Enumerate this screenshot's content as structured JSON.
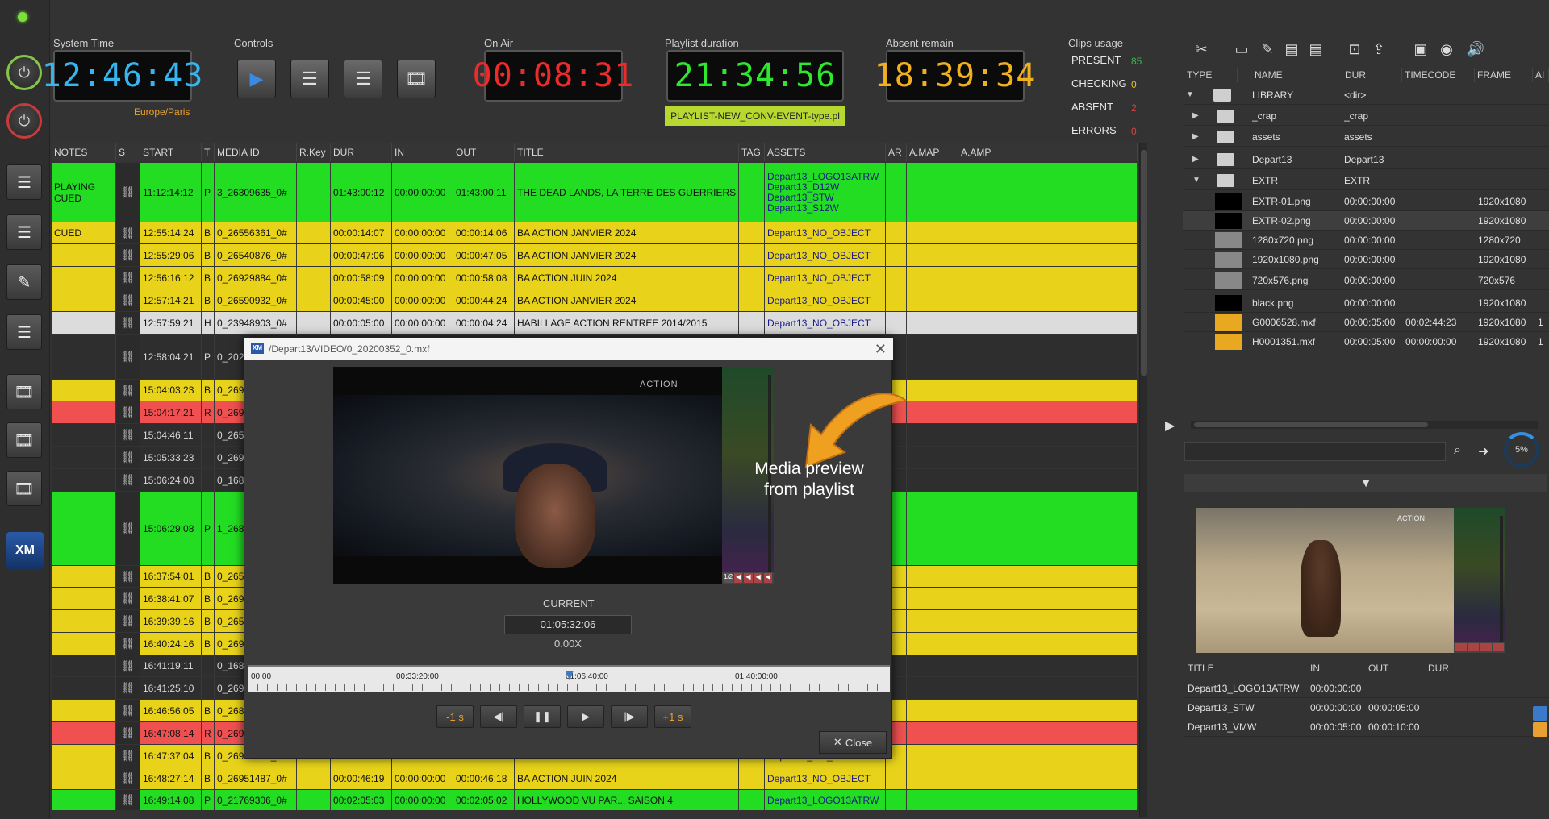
{
  "header": {
    "system_time_label": "System Time",
    "system_time": "12:46:43",
    "timezone": "Europe/Paris",
    "controls_label": "Controls",
    "on_air_label": "On Air",
    "on_air": "00:08:31",
    "playlist_duration_label": "Playlist duration",
    "playlist_duration": "21:34:56",
    "playlist_name": "PLAYLIST-NEW_CONV-EVENT-type.pl",
    "absent_remain_label": "Absent remain",
    "absent_remain": "18:39:34",
    "clips_usage_label": "Clips usage",
    "clips_usage": [
      {
        "label": "PRESENT",
        "value": "85",
        "color": "#39b54a"
      },
      {
        "label": "CHECKING",
        "value": "0",
        "color": "#e8c21a"
      },
      {
        "label": "ABSENT",
        "value": "2",
        "color": "#e04040"
      },
      {
        "label": "ERRORS",
        "value": "0",
        "color": "#e04040"
      }
    ]
  },
  "playlist": {
    "columns": [
      "NOTES",
      "S",
      "START",
      "T",
      "MEDIA ID",
      "R.Key",
      "DUR",
      "IN",
      "OUT",
      "TITLE",
      "TAG",
      "ASSETS",
      "AR",
      "A.MAP",
      "A.AMP"
    ],
    "rows": [
      {
        "notes": "PLAYING CUED",
        "start": "11:12:14:12",
        "t": "P",
        "media": "3_26309635_0#",
        "dur": "01:43:00:12",
        "in": "00:00:00:00",
        "out": "01:43:00:11",
        "title": "THE DEAD LANDS, LA TERRE DES GUERRIERS",
        "assets": "Depart13_LOGO13ATRW",
        "assets2": "Depart13_D12W",
        "assets3": "Depart13_STW",
        "assets4": "Depart13_S12W"
      },
      {
        "notes": "CUED",
        "start": "12:55:14:24",
        "t": "B",
        "media": "0_26556361_0#",
        "dur": "00:00:14:07",
        "in": "00:00:00:00",
        "out": "00:00:14:06",
        "title": "BA ACTION JANVIER 2024",
        "assets": "Depart13_NO_OBJECT"
      },
      {
        "notes": "",
        "start": "12:55:29:06",
        "t": "B",
        "media": "0_26540876_0#",
        "dur": "00:00:47:06",
        "in": "00:00:00:00",
        "out": "00:00:47:05",
        "title": "BA ACTION JANVIER 2024",
        "assets": "Depart13_NO_OBJECT"
      },
      {
        "notes": "",
        "start": "12:56:16:12",
        "t": "B",
        "media": "0_26929884_0#",
        "dur": "00:00:58:09",
        "in": "00:00:00:00",
        "out": "00:00:58:08",
        "title": "BA ACTION JUIN 2024",
        "assets": "Depart13_NO_OBJECT"
      },
      {
        "notes": "",
        "start": "12:57:14:21",
        "t": "B",
        "media": "0_26590932_0#",
        "dur": "00:00:45:00",
        "in": "00:00:00:00",
        "out": "00:00:44:24",
        "title": "BA ACTION JANVIER 2024",
        "assets": "Depart13_NO_OBJECT"
      },
      {
        "notes": "",
        "start": "12:57:59:21",
        "t": "H",
        "media": "0_23948903_0#",
        "dur": "00:00:05:00",
        "in": "00:00:00:00",
        "out": "00:00:04:24",
        "title": "HABILLAGE ACTION RENTREE 2014/2015",
        "assets": "Depart13_NO_OBJECT"
      },
      {
        "notes": "",
        "start": "12:58:04:21",
        "t": "P",
        "media": "0_202",
        "dur": "",
        "in": "",
        "out": "",
        "title": "",
        "assets": ""
      },
      {
        "notes": "",
        "start": "15:04:03:23",
        "t": "B",
        "media": "0_269",
        "dur": "",
        "in": "",
        "out": "",
        "title": "",
        "assets": ""
      },
      {
        "notes": "",
        "start": "15:04:17:21",
        "t": "R",
        "media": "0_269",
        "dur": "",
        "in": "",
        "out": "",
        "title": "",
        "assets": ""
      },
      {
        "notes": "",
        "start": "15:04:46:11",
        "t": "",
        "media": "0_265",
        "dur": "",
        "in": "",
        "out": "",
        "title": "",
        "assets": ""
      },
      {
        "notes": "",
        "start": "15:05:33:23",
        "t": "",
        "media": "0_269",
        "dur": "",
        "in": "",
        "out": "",
        "title": "",
        "assets": ""
      },
      {
        "notes": "",
        "start": "15:06:24:08",
        "t": "",
        "media": "0_168",
        "dur": "",
        "in": "",
        "out": "",
        "title": "",
        "assets": ""
      },
      {
        "notes": "",
        "start": "15:06:29:08",
        "t": "P",
        "media": "1_268",
        "dur": "",
        "in": "",
        "out": "",
        "title": "",
        "assets": ""
      },
      {
        "notes": "",
        "start": "16:37:54:01",
        "t": "B",
        "media": "0_265",
        "dur": "",
        "in": "",
        "out": "",
        "title": "",
        "assets": ""
      },
      {
        "notes": "",
        "start": "16:38:41:07",
        "t": "B",
        "media": "0_269",
        "dur": "",
        "in": "",
        "out": "",
        "title": "",
        "assets": ""
      },
      {
        "notes": "",
        "start": "16:39:39:16",
        "t": "B",
        "media": "0_265",
        "dur": "",
        "in": "",
        "out": "",
        "title": "",
        "assets": ""
      },
      {
        "notes": "",
        "start": "16:40:24:16",
        "t": "B",
        "media": "0_269",
        "dur": "",
        "in": "",
        "out": "",
        "title": "",
        "assets": ""
      },
      {
        "notes": "",
        "start": "16:41:19:11",
        "t": "",
        "media": "0_168",
        "dur": "",
        "in": "",
        "out": "",
        "title": "",
        "assets": ""
      },
      {
        "notes": "",
        "start": "16:41:25:10",
        "t": "",
        "media": "0_269",
        "dur": "",
        "in": "",
        "out": "",
        "title": "",
        "assets": ""
      },
      {
        "notes": "",
        "start": "16:46:56:05",
        "t": "B",
        "media": "0_268",
        "dur": "",
        "in": "",
        "out": "",
        "title": "",
        "assets": ""
      },
      {
        "notes": "",
        "start": "16:47:08:14",
        "t": "R",
        "media": "0_269",
        "dur": "",
        "in": "",
        "out": "",
        "title": "",
        "assets": ""
      },
      {
        "notes": "",
        "start": "16:47:37:04",
        "t": "B",
        "media": "0_26919313_0#",
        "dur": "00:00:50:10",
        "in": "00:00:00:00",
        "out": "00:00:50:09",
        "title": "BA ACTION JUIN 2024",
        "assets": "Depart13_NO_OBJECT"
      },
      {
        "notes": "",
        "start": "16:48:27:14",
        "t": "B",
        "media": "0_26951487_0#",
        "dur": "00:00:46:19",
        "in": "00:00:00:00",
        "out": "00:00:46:18",
        "title": "BA ACTION JUIN 2024",
        "assets": "Depart13_NO_OBJECT"
      },
      {
        "notes": "",
        "start": "16:49:14:08",
        "t": "P",
        "media": "0_21769306_0#",
        "dur": "00:02:05:03",
        "in": "00:00:00:00",
        "out": "00:02:05:02",
        "title": "HOLLYWOOD VU PAR... SAISON 4",
        "assets": "Depart13_LOGO13ATRW"
      }
    ]
  },
  "dialog": {
    "title": "/Depart13/VIDEO/0_20200352_0.mxf",
    "watermark": "ACTION",
    "meter_label": "1/2",
    "callout_line1": "Media preview",
    "callout_line2": "from playlist",
    "current_label": "CURRENT",
    "current_tc": "01:05:32:06",
    "speed": "0.00X",
    "timeline_ticks": [
      "00:00",
      "00:33:20:00",
      "01:06:40:00",
      "01:40:00:00"
    ],
    "buttons": {
      "back1s": "-1 s",
      "prev": "◀|",
      "pause": "❚❚",
      "play": "▶",
      "next": "|▶",
      "fwd1s": "+1 s"
    },
    "close_label": "Close"
  },
  "library": {
    "columns": [
      "TYPE",
      "NAME",
      "DUR",
      "TIMECODE",
      "FRAME",
      "AI"
    ],
    "rows": [
      {
        "expander": "▼",
        "name": "LIBRARY",
        "dur": "<dir>",
        "tc": "",
        "frame": "",
        "kind": "folder",
        "level": 0
      },
      {
        "expander": "▶",
        "name": "_crap",
        "dur": "_crap",
        "tc": "",
        "frame": "",
        "kind": "folder",
        "level": 1
      },
      {
        "expander": "▶",
        "name": "assets",
        "dur": "assets",
        "tc": "",
        "frame": "",
        "kind": "folder",
        "level": 1
      },
      {
        "expander": "▶",
        "name": "Depart13",
        "dur": "Depart13",
        "tc": "",
        "frame": "",
        "kind": "folder",
        "level": 1
      },
      {
        "expander": "▼",
        "name": "EXTR",
        "dur": "EXTR",
        "tc": "",
        "frame": "",
        "kind": "folder",
        "level": 1
      },
      {
        "expander": "",
        "name": "EXTR-01.png",
        "dur": "00:00:00:00",
        "tc": "",
        "frame": "1920x1080",
        "kind": "black",
        "level": 2
      },
      {
        "expander": "",
        "name": "EXTR-02.png",
        "dur": "00:00:00:00",
        "tc": "",
        "frame": "1920x1080",
        "kind": "black",
        "level": 2
      },
      {
        "expander": "",
        "name": "1280x720.png",
        "dur": "00:00:00:00",
        "tc": "",
        "frame": "1280x720",
        "kind": "gray",
        "level": 1
      },
      {
        "expander": "",
        "name": "1920x1080.png",
        "dur": "00:00:00:00",
        "tc": "",
        "frame": "1920x1080",
        "kind": "gray",
        "level": 1
      },
      {
        "expander": "",
        "name": "720x576.png",
        "dur": "00:00:00:00",
        "tc": "",
        "frame": "720x576",
        "kind": "gray",
        "level": 1
      },
      {
        "expander": "",
        "name": "black.png",
        "dur": "00:00:00:00",
        "tc": "",
        "frame": "1920x1080",
        "kind": "black",
        "level": 1
      },
      {
        "expander": "",
        "name": "G0006528.mxf",
        "dur": "00:00:05:00",
        "tc": "00:02:44:23",
        "frame": "1920x1080",
        "ai": "1",
        "kind": "clip",
        "level": 1
      },
      {
        "expander": "",
        "name": "H0001351.mxf",
        "dur": "00:00:05:00",
        "tc": "00:00:00:00",
        "frame": "1920x1080",
        "ai": "1",
        "kind": "clip",
        "level": 1
      }
    ],
    "search_placeholder": "",
    "progress": "5%",
    "collapse_icon": "▼",
    "preview_watermark": "ACTION"
  },
  "assets_table": {
    "columns": [
      "TITLE",
      "IN",
      "OUT",
      "DUR"
    ],
    "rows": [
      {
        "title": "Depart13_LOGO13ATRW",
        "in": "00:00:00:00",
        "out": "",
        "dur": ""
      },
      {
        "title": "Depart13_STW",
        "in": "00:00:00:00",
        "out": "00:00:05:00",
        "dur": ""
      },
      {
        "title": "Depart13_VMW",
        "in": "00:00:05:00",
        "out": "00:00:10:00",
        "dur": ""
      }
    ]
  },
  "colors": {
    "green_row": "#22dd22",
    "yellow_row": "#e8d31a",
    "red_row": "#f05050",
    "white_row": "#dcdcdc",
    "clock_blue": "#35b6f0",
    "clock_red": "#ee2a2a",
    "clock_green": "#2ee82e",
    "clock_yellow": "#f0b020",
    "accent_orange": "#e8a030"
  }
}
